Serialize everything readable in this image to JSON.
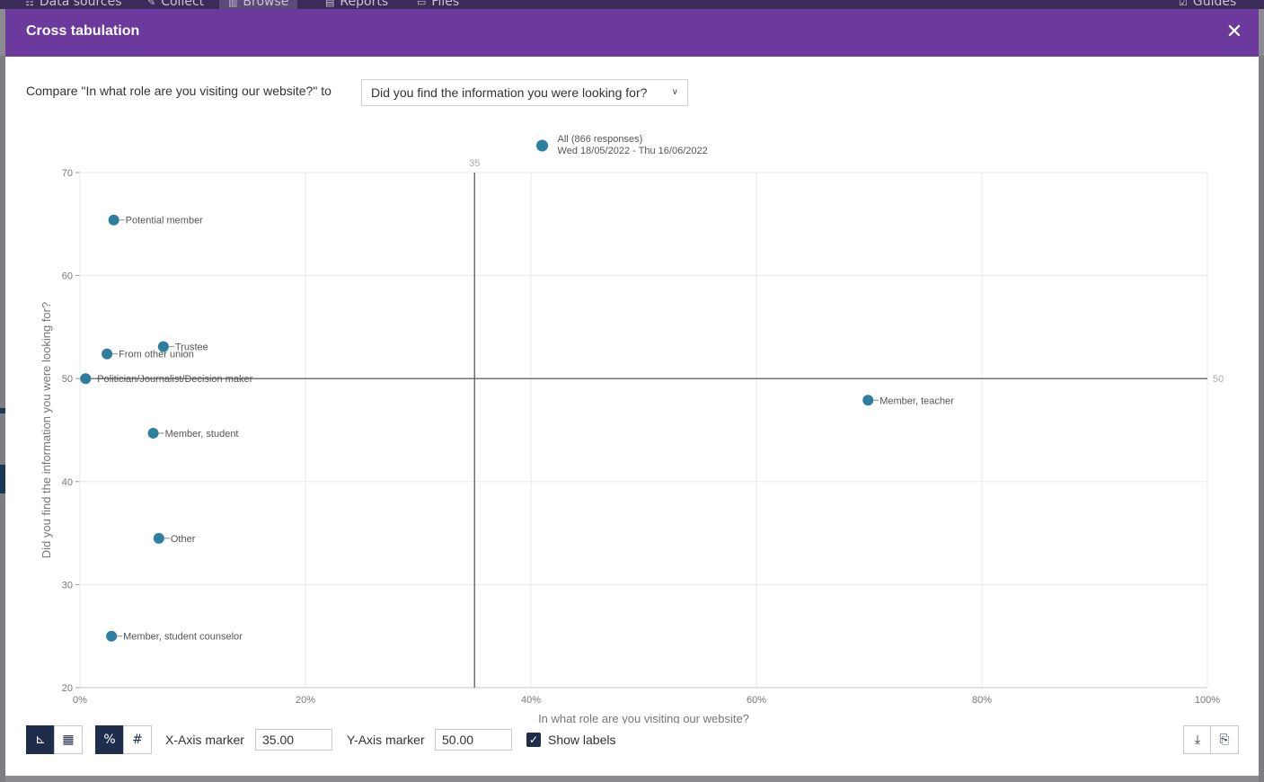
{
  "nav": {
    "items": [
      {
        "label": "Data sources",
        "icon": "database-icon",
        "glyph": "⚏"
      },
      {
        "label": "Collect",
        "icon": "edit-icon",
        "glyph": "✎"
      },
      {
        "label": "Browse",
        "icon": "bar-chart-icon",
        "glyph": "▥"
      },
      {
        "label": "Reports",
        "icon": "document-icon",
        "glyph": "▤"
      },
      {
        "label": "Files",
        "icon": "folder-icon",
        "glyph": "▭"
      }
    ],
    "guides_label": "Guides"
  },
  "modal": {
    "title": "Cross tabulation",
    "close_glyph": "✕",
    "compare_label": "Compare \"In what role are you visiting our website?\" to",
    "compare_value": "Did you find the information you were looking for?",
    "chevron_glyph": "∨"
  },
  "chart_data": {
    "type": "scatter",
    "xlabel": "In what role are you visiting our website?",
    "ylabel": "Did you find the information you were looking for?",
    "xlim": [
      0,
      100
    ],
    "ylim": [
      20,
      70
    ],
    "xticks": [
      "0%",
      "20%",
      "40%",
      "60%",
      "80%",
      "100%"
    ],
    "yticks": [
      "20",
      "30",
      "40",
      "50",
      "60",
      "70"
    ],
    "grid": true,
    "x_marker": 35,
    "y_marker": 50,
    "x_marker_label": "35",
    "y_marker_label": "50",
    "color": "#2e7ea0",
    "all_point": {
      "x": 41,
      "line1": "All (866 responses)",
      "line2": "Wed 18/05/2022 - Thu 16/06/2022"
    },
    "points": [
      {
        "label": "Potential member",
        "x": 3.0,
        "y": 65.4
      },
      {
        "label": "Trustee",
        "x": 7.4,
        "y": 53.1
      },
      {
        "label": "From other union",
        "x": 2.4,
        "y": 52.4
      },
      {
        "label": "Politician/Journalist/Decision maker",
        "x": 0.5,
        "y": 50.0
      },
      {
        "label": "Member, teacher",
        "x": 69.9,
        "y": 47.9
      },
      {
        "label": "Member, student",
        "x": 6.5,
        "y": 44.7
      },
      {
        "label": "Other",
        "x": 7.0,
        "y": 34.5
      },
      {
        "label": "Member, student counselor",
        "x": 2.8,
        "y": 25.0
      }
    ]
  },
  "toolbar": {
    "chart_view_glyph": "⊾",
    "table_view_glyph": "▦",
    "percent_glyph": "%",
    "count_glyph": "#",
    "x_marker_label": "X-Axis marker",
    "x_marker_value": "35.00",
    "y_marker_label": "Y-Axis marker",
    "y_marker_value": "50.00",
    "show_labels_label": "Show labels",
    "check_glyph": "✓",
    "download_glyph": "⤓",
    "export_glyph": "⎘"
  }
}
